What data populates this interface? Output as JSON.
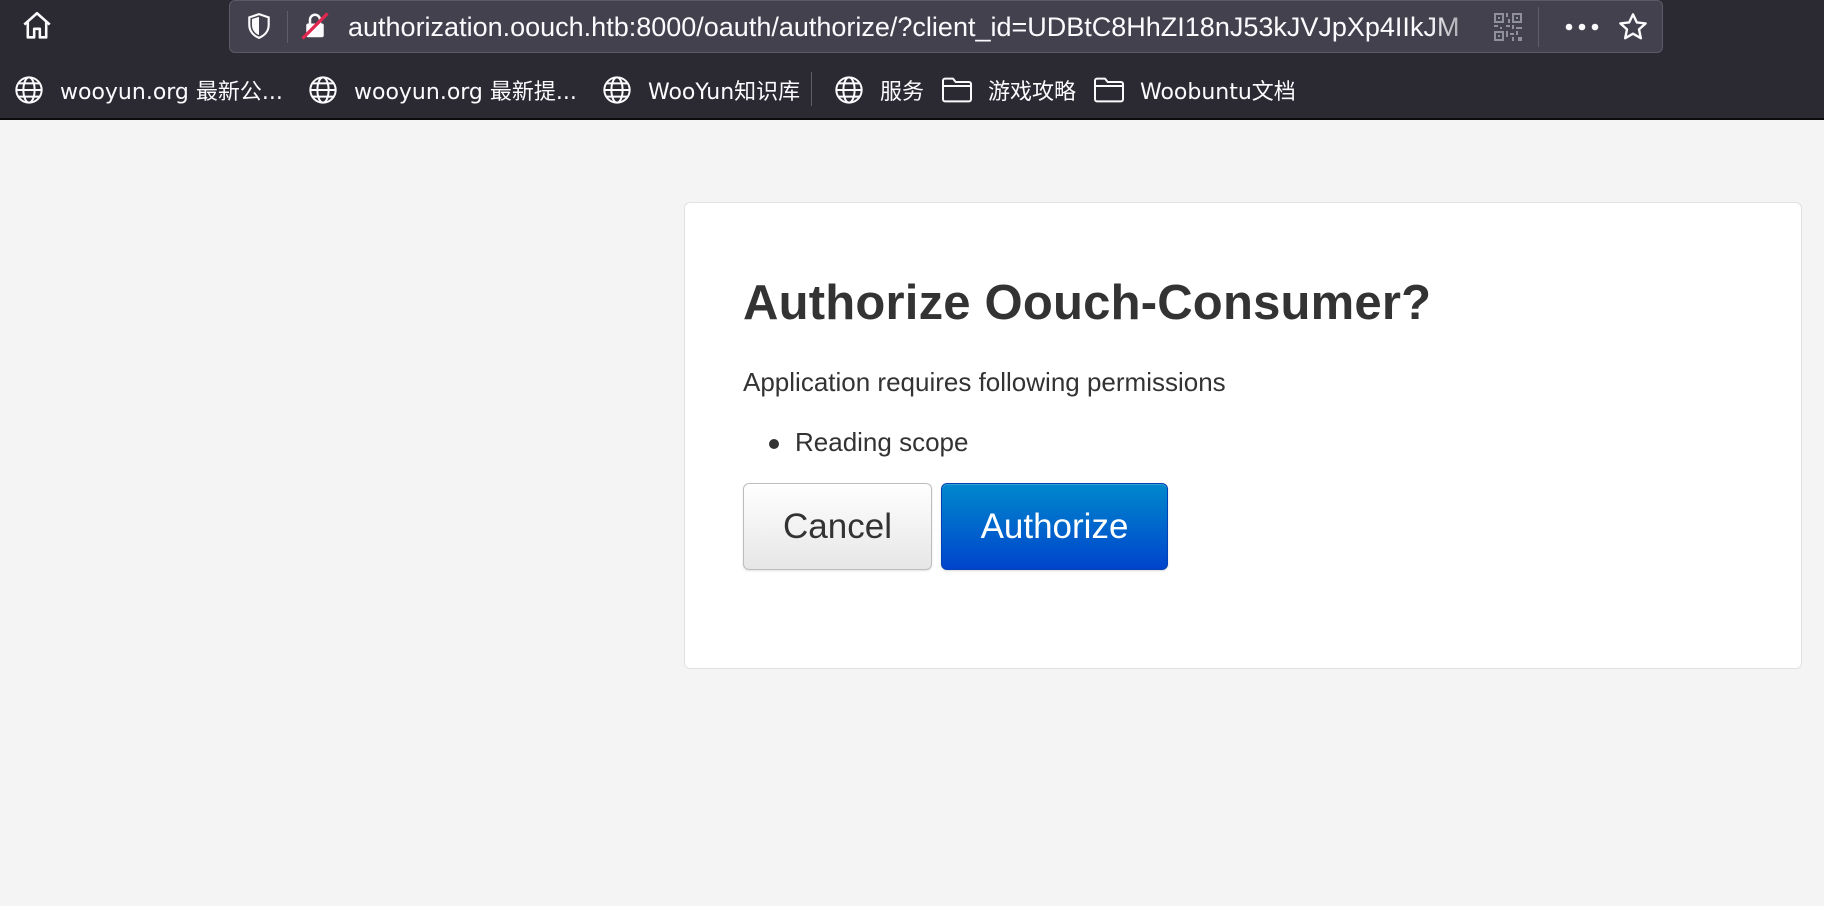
{
  "browser": {
    "url": "authorization.oouch.htb:8000/oauth/authorize/?client_id=UDBtC8HhZI18nJ53kJVJpXp4IIkJM",
    "icons": {
      "home": "home-icon",
      "tracking_protection": "shield-icon",
      "connection": "insecure-lock-icon",
      "qr": "qr-code-icon",
      "page_actions": "more-icon",
      "bookmark": "star-icon"
    }
  },
  "bookmarks": [
    {
      "label": "wooyun.org 最新公...",
      "icon": "globe-icon"
    },
    {
      "label": "wooyun.org 最新提...",
      "icon": "globe-icon"
    },
    {
      "label": "WooYun知识库",
      "icon": "globe-icon"
    },
    {
      "label": "服务",
      "icon": "globe-icon"
    },
    {
      "label": "游戏攻略",
      "icon": "folder-icon"
    },
    {
      "label": "Woobuntu文档",
      "icon": "folder-icon"
    }
  ],
  "dialog": {
    "title": "Authorize Oouch-Consumer?",
    "subtitle": "Application requires following permissions",
    "permissions": [
      "Reading scope"
    ],
    "cancel_label": "Cancel",
    "authorize_label": "Authorize"
  },
  "colors": {
    "toolbar_bg": "#2b2a33",
    "urlbar_bg": "#42414d",
    "page_bg": "#f4f4f4",
    "primary_button": "#0055cc",
    "text": "#333333"
  }
}
